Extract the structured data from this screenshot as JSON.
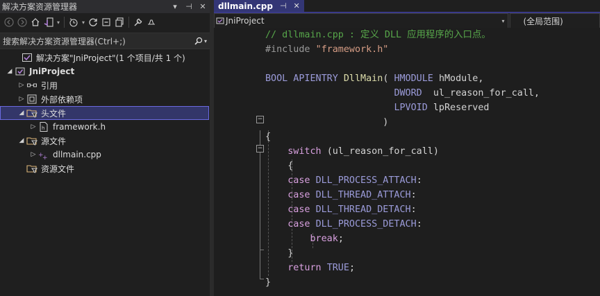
{
  "solution_explorer": {
    "title": "解决方案资源管理器",
    "title_buttons": [
      "▾",
      "⊣",
      "✕"
    ],
    "search_placeholder": "搜索解决方案资源管理器(Ctrl+;)",
    "tree": [
      {
        "label": "解决方案\"JniProject\"(1 个项目/共 1 个)",
        "icon": "solution-icon",
        "level": 0,
        "arrow": ""
      },
      {
        "label": "JniProject",
        "icon": "project-icon",
        "level": 0,
        "arrow": "◢",
        "bold": true
      },
      {
        "label": "引用",
        "icon": "references-icon",
        "level": 1,
        "arrow": "▷"
      },
      {
        "label": "外部依赖项",
        "icon": "external-dependencies-icon",
        "level": 1,
        "arrow": "▷"
      },
      {
        "label": "头文件",
        "icon": "filter-folder-icon",
        "level": 1,
        "arrow": "◢",
        "selected": true
      },
      {
        "label": "framework.h",
        "icon": "header-file-icon",
        "level": 2,
        "arrow": "▷"
      },
      {
        "label": "源文件",
        "icon": "filter-folder-icon",
        "level": 1,
        "arrow": "◢"
      },
      {
        "label": "dllmain.cpp",
        "icon": "cpp-file-icon",
        "level": 2,
        "arrow": "▷"
      },
      {
        "label": "资源文件",
        "icon": "filter-folder-icon",
        "level": 1,
        "arrow": ""
      }
    ]
  },
  "editor": {
    "tab": {
      "label": "dllmain.cpp",
      "pin": "⊣",
      "close": "✕"
    },
    "nav_project": "JniProject",
    "nav_scope": "(全局范围)",
    "lines": [
      [
        {
          "c": "c-com",
          "t": "// dllmain.cpp : 定义 DLL 应用程序的入口点。"
        }
      ],
      [
        {
          "c": "c-pre",
          "t": "#include "
        },
        {
          "c": "c-str",
          "t": "\"framework.h\""
        }
      ],
      [],
      [
        {
          "c": "c-def",
          "t": "BOOL APIENTRY "
        },
        {
          "c": "c-fn",
          "t": "DllMain"
        },
        {
          "c": "c-tx",
          "t": "( "
        },
        {
          "c": "c-def",
          "t": "HMODULE "
        },
        {
          "c": "c-tx",
          "t": "hModule,"
        }
      ],
      [
        {
          "c": "c-tx",
          "t": "                       "
        },
        {
          "c": "c-def",
          "t": "DWORD  "
        },
        {
          "c": "c-tx",
          "t": "ul_reason_for_call,"
        }
      ],
      [
        {
          "c": "c-tx",
          "t": "                       "
        },
        {
          "c": "c-def",
          "t": "LPVOID "
        },
        {
          "c": "c-tx",
          "t": "lpReserved"
        }
      ],
      [
        {
          "c": "c-tx",
          "t": "                     )"
        }
      ],
      [
        {
          "c": "c-tx",
          "t": "{"
        }
      ],
      [
        {
          "c": "c-tx",
          "t": "    "
        },
        {
          "c": "c-kw2",
          "t": "switch "
        },
        {
          "c": "c-tx",
          "t": "(ul_reason_for_call)"
        }
      ],
      [
        {
          "c": "c-tx",
          "t": "    {"
        }
      ],
      [
        {
          "c": "c-tx",
          "t": "    "
        },
        {
          "c": "c-kw2",
          "t": "case "
        },
        {
          "c": "c-def",
          "t": "DLL_PROCESS_ATTACH"
        },
        {
          "c": "c-tx",
          "t": ":"
        }
      ],
      [
        {
          "c": "c-tx",
          "t": "    "
        },
        {
          "c": "c-kw2",
          "t": "case "
        },
        {
          "c": "c-def",
          "t": "DLL_THREAD_ATTACH"
        },
        {
          "c": "c-tx",
          "t": ":"
        }
      ],
      [
        {
          "c": "c-tx",
          "t": "    "
        },
        {
          "c": "c-kw2",
          "t": "case "
        },
        {
          "c": "c-def",
          "t": "DLL_THREAD_DETACH"
        },
        {
          "c": "c-tx",
          "t": ":"
        }
      ],
      [
        {
          "c": "c-tx",
          "t": "    "
        },
        {
          "c": "c-kw2",
          "t": "case "
        },
        {
          "c": "c-def",
          "t": "DLL_PROCESS_DETACH"
        },
        {
          "c": "c-tx",
          "t": ":"
        }
      ],
      [
        {
          "c": "c-tx",
          "t": "        "
        },
        {
          "c": "c-kw2",
          "t": "break"
        },
        {
          "c": "c-tx",
          "t": ";"
        }
      ],
      [
        {
          "c": "c-tx",
          "t": "    }"
        }
      ],
      [
        {
          "c": "c-tx",
          "t": "    "
        },
        {
          "c": "c-kw2",
          "t": "return "
        },
        {
          "c": "c-def",
          "t": "TRUE"
        },
        {
          "c": "c-tx",
          "t": ";"
        }
      ],
      [
        {
          "c": "c-tx",
          "t": "}"
        }
      ]
    ]
  }
}
